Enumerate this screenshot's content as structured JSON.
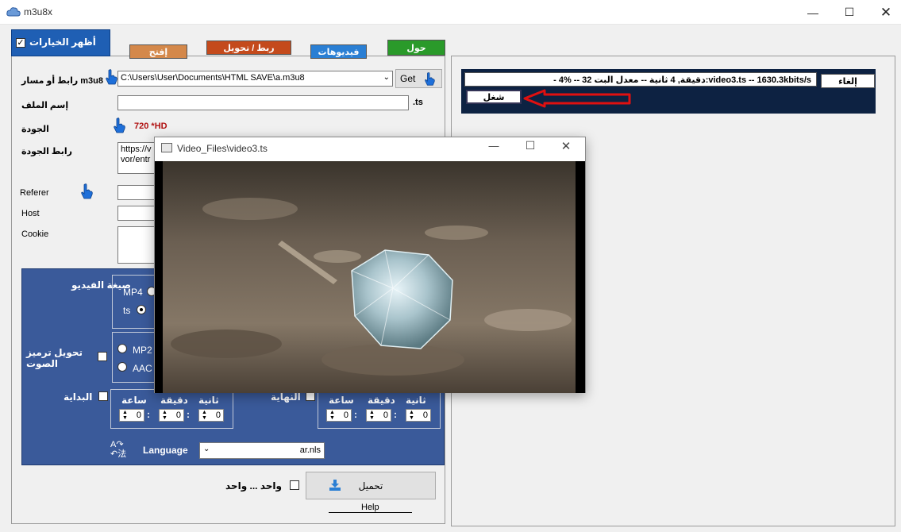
{
  "window": {
    "title": "m3u8x"
  },
  "options_toggle": {
    "label": "أظهر الخيارات",
    "checked": true
  },
  "tabs": [
    {
      "label": "إفتح",
      "color": "#d4884a"
    },
    {
      "label": "ربط / تحويل",
      "color": "#c44a1c"
    },
    {
      "label": "فيديوهات",
      "color": "#2a7fd4"
    },
    {
      "label": "حول",
      "color": "#2a9a2a"
    }
  ],
  "form": {
    "path_label": "رابط أو مسار m3u8",
    "path_value": "C:\\Users\\User\\Documents\\HTML SAVE\\a.m3u8",
    "get_label": "Get",
    "filename_label": "إسم الملف",
    "filename_value": "",
    "ext_label": ".ts",
    "quality_label": "الجودة",
    "quality_value": "720 *HD",
    "quality_url_label": "رابط الجودة",
    "quality_url_line1": "https://v",
    "quality_url_line2": "vor/entr",
    "referer_label": "Referer",
    "host_label": "Host",
    "cookie_label": "Cookie"
  },
  "options": {
    "format_label": "صيغة الفيديو",
    "format_options": [
      "MP4",
      "ts"
    ],
    "format_selected": "ts",
    "audio_label_line1": "تحويل ترميز",
    "audio_label_line2": "الصوت",
    "audio_options": [
      "MP2",
      "AAC"
    ],
    "start_label": "البداية",
    "end_label": "النهاية",
    "units": {
      "hour": "ساعة",
      "minute": "دقيقة",
      "second": "ثانية"
    },
    "start_values": {
      "hour": "0",
      "minute": "0",
      "second": "0"
    },
    "end_values": {
      "hour": "0",
      "minute": "0",
      "second": "0"
    },
    "language_label": "Language",
    "language_value": "ar.nls"
  },
  "bottom": {
    "one_by_one_label": "واحد ... واحد",
    "download_label": "تحميل",
    "help_label": "Help"
  },
  "download": {
    "progress_text": "- 4% -- 32 دقيقة, 4 ثانية -- معدل البت:video3.ts  --  1630.3kbits/s",
    "cancel_label": "إلغاء",
    "play_label": "شغل"
  },
  "video_window": {
    "title": "Video_Files\\video3.ts"
  },
  "colors": {
    "accent_blue": "#1f5fb4",
    "panel_blue": "#3a5a9a",
    "dark_navy": "#0d2242",
    "arrow_red": "#e01010",
    "quality_red": "#b01010"
  }
}
